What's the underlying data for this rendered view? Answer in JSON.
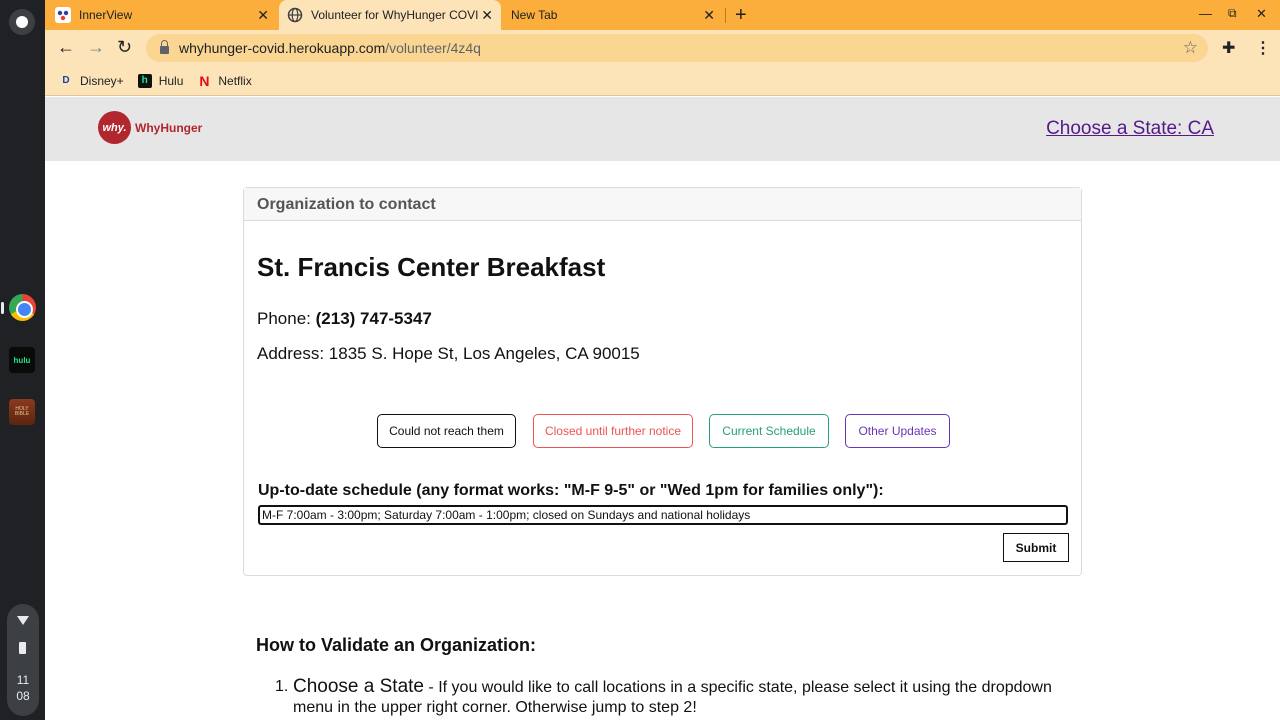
{
  "shelf": {
    "clock_hour": "11",
    "clock_min": "08",
    "hulu_label": "hulu",
    "bible_label": "HOLY BIBLE"
  },
  "tabs": [
    {
      "title": "InnerView",
      "active": false
    },
    {
      "title": "Volunteer for WhyHunger COVID",
      "active": true
    },
    {
      "title": "New Tab",
      "active": false
    }
  ],
  "omnibox": {
    "host": "whyhunger-covid.herokuapp.com",
    "path": "/volunteer/4z4q"
  },
  "bookmarks": [
    {
      "label": "Disney+"
    },
    {
      "label": "Hulu"
    },
    {
      "label": "Netflix"
    }
  ],
  "header": {
    "logo_mark": "why.",
    "logo_text": "WhyHunger",
    "state_link": "Choose a State: CA"
  },
  "card": {
    "heading": "Organization to contact",
    "org_name": "St. Francis Center Breakfast",
    "phone_label": "Phone:",
    "phone_value": "(213) 747-5347",
    "address": "Address: 1835 S. Hope St, Los Angeles, CA 90015",
    "buttons": [
      {
        "label": "Could not reach them",
        "color": "#111111"
      },
      {
        "label": "Closed until further notice",
        "color": "#ef5350"
      },
      {
        "label": "Current Schedule",
        "color": "#26a17a"
      },
      {
        "label": "Other Updates",
        "color": "#6a34b8"
      }
    ],
    "schedule_label": "Up-to-date schedule (any format works: \"M-F 9-5\" or \"Wed 1pm for families only\"):",
    "schedule_value": "M-F 7:00am - 3:00pm; Saturday 7:00am - 1:00pm; closed on Sundays and national holidays",
    "submit_label": "Submit"
  },
  "howto": {
    "title": "How to Validate an Organization:",
    "steps": [
      {
        "num": "1.",
        "title": "Choose a State",
        "text": " - If you would like to call locations in a specific state, please select it using the dropdown menu in the upper right corner. Otherwise jump to step 2!"
      }
    ]
  },
  "colors": {
    "tabstrip": "#fbae3c",
    "toolbar": "#fde4b8",
    "brand_red": "#b1272d",
    "link_purple": "#551a8b"
  }
}
